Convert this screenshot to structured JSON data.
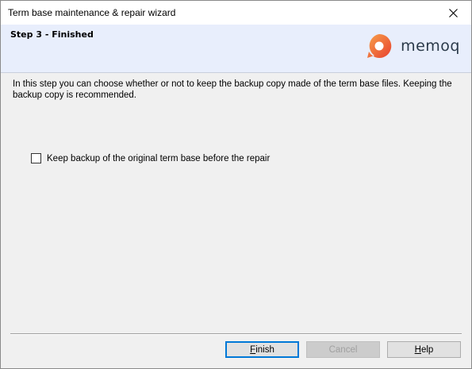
{
  "window": {
    "title": "Term base maintenance & repair wizard"
  },
  "header": {
    "step_title": "Step 3 - Finished",
    "logo_text": "memoq",
    "logo_icon": "memoq-logo-icon",
    "logo_color": "#f04e37"
  },
  "body": {
    "description": "In this step you can choose whether or not to keep the backup copy made of the term base files. Keeping the backup copy is recommended.",
    "checkbox": {
      "label": "Keep backup of the original term base before the repair",
      "checked": false
    }
  },
  "buttons": {
    "finish": {
      "mnemonic": "F",
      "rest": "inish"
    },
    "cancel": {
      "label": "Cancel"
    },
    "help": {
      "mnemonic": "H",
      "rest": "elp"
    }
  }
}
